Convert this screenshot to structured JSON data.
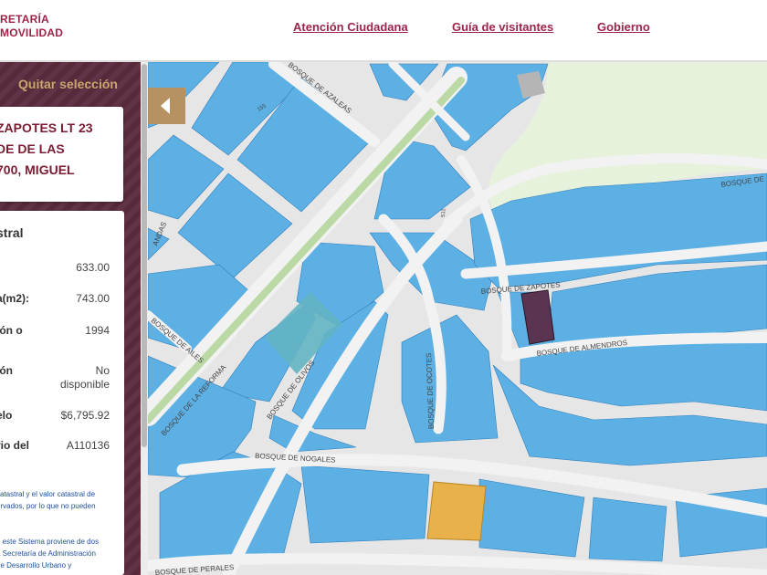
{
  "header": {
    "logo_line1": "RETARÍA",
    "logo_line2": "MOVILIDAD",
    "nav": [
      "Atención Ciudadana",
      "Guía de visitantes",
      "Gobierno"
    ]
  },
  "sidebar": {
    "clear_selection": "Quitar selección",
    "address_lines": [
      "ZAPOTES LT 23",
      "DE DE LAS",
      "700, MIGUEL"
    ],
    "section_title": "stral",
    "rows": [
      {
        "label": "",
        "value": "633.00"
      },
      {
        "label": "a(m2):",
        "value": "743.00"
      },
      {
        "label": "ión o",
        "value": "1994"
      },
      {
        "label": "ión",
        "value": "No"
      },
      {
        "label": "",
        "value": "disponible"
      },
      {
        "label": "elo",
        "value": "$6,795.92"
      },
      {
        "label": "rio del",
        "value": "A110136"
      }
    ],
    "notes": [
      "catastral y el valor catastral de",
      "ervados, por lo que no pueden",
      "n este Sistema proviene de dos",
      "a Secretaría de Administración",
      "de Desarrollo Urbano y"
    ]
  },
  "map": {
    "streets": [
      "BOSQUE DE AZALEAS",
      "BOSQUE DE ZAPOTES",
      "BOSQUE DE ALMENDROS",
      "BOSQUE DE OLIVOS",
      "BOSQUE DE OCOTES",
      "BOSQUE DE NOGALES",
      "BOSQUE DE PERALES",
      "BOSQUE DE LA REFORMA",
      "BOSQUE DE AILES",
      "BOSQUE DE",
      "ANDAS"
    ],
    "house_numbers": [
      "155",
      "511"
    ],
    "colors": {
      "parcel": "#5db0e4",
      "parcel_stroke": "#2f7fbd",
      "street": "#e4e4e4",
      "median": "#bad9a4",
      "park": "#e6f2dc",
      "selected": "#5a3450",
      "highlight": "#e8b14a",
      "teal": "#63b4c3"
    }
  },
  "controls": {
    "collapse_icon": "chevron-left-icon"
  }
}
